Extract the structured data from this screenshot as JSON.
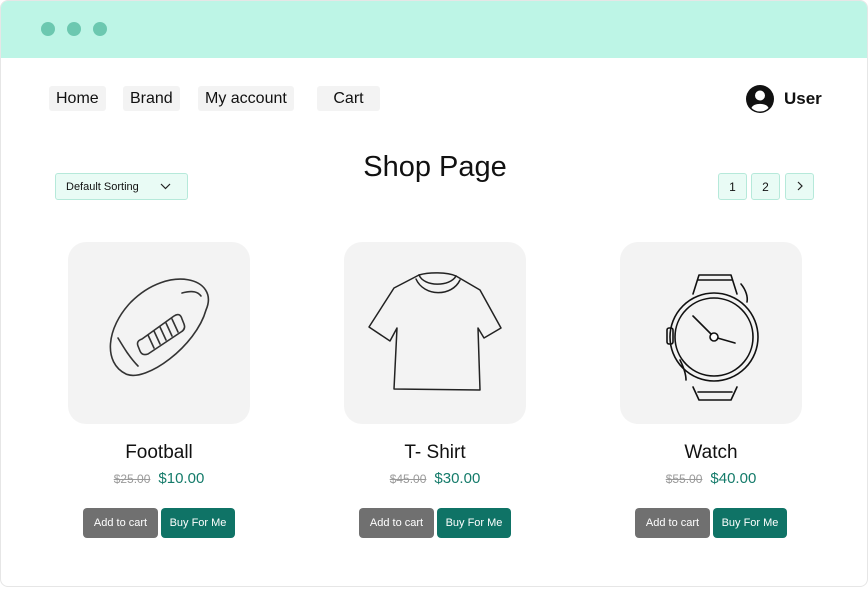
{
  "nav": [
    {
      "label": "Home"
    },
    {
      "label": "Brand"
    },
    {
      "label": "My account"
    },
    {
      "label": "Cart"
    }
  ],
  "user": {
    "label": "User",
    "icon": "user-avatar-icon"
  },
  "page": {
    "title": "Shop Page"
  },
  "sorting": {
    "label": "Default Sorting",
    "icon": "chevron-down-icon"
  },
  "pagination": {
    "pages": [
      "1",
      "2"
    ],
    "next_icon": "chevron-right-icon"
  },
  "products": [
    {
      "name": "Football",
      "old_price": "$25.00",
      "price": "$10.00",
      "icon": "football-icon",
      "add_label": "Add to cart",
      "buy_label": "Buy For Me"
    },
    {
      "name": "T- Shirt",
      "old_price": "$45.00",
      "price": "$30.00",
      "icon": "tshirt-icon",
      "add_label": "Add to cart",
      "buy_label": "Buy For Me"
    },
    {
      "name": "Watch",
      "old_price": "$55.00",
      "price": "$40.00",
      "icon": "watch-icon",
      "add_label": "Add to cart",
      "buy_label": "Buy For Me"
    }
  ],
  "colors": {
    "titlebar": "#bdf5e6",
    "accent": "#0f7366",
    "secondary_button": "#707070"
  }
}
